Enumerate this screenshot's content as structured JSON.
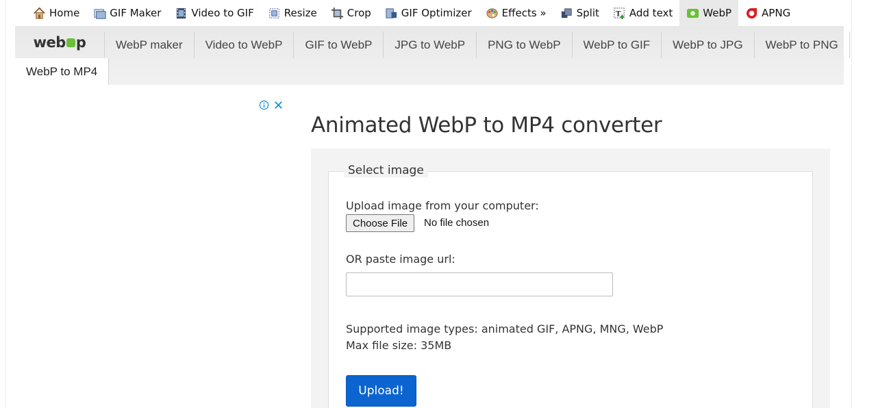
{
  "topnav": {
    "items": [
      {
        "label": "Home",
        "icon": "home-icon"
      },
      {
        "label": "GIF Maker",
        "icon": "gif-maker-icon"
      },
      {
        "label": "Video to GIF",
        "icon": "film-icon"
      },
      {
        "label": "Resize",
        "icon": "resize-icon"
      },
      {
        "label": "Crop",
        "icon": "crop-icon"
      },
      {
        "label": "GIF Optimizer",
        "icon": "optimizer-icon"
      },
      {
        "label": "Effects »",
        "icon": "palette-icon"
      },
      {
        "label": "Split",
        "icon": "split-icon"
      },
      {
        "label": "Add text",
        "icon": "add-text-icon"
      },
      {
        "label": "WebP",
        "icon": "webp-icon"
      },
      {
        "label": "APNG",
        "icon": "apng-icon"
      }
    ],
    "active": "WebP"
  },
  "subnav": {
    "logo_left": "web",
    "logo_right": "p",
    "links": [
      "WebP maker",
      "Video to WebP",
      "GIF to WebP",
      "JPG to WebP",
      "PNG to WebP",
      "WebP to GIF",
      "WebP to JPG",
      "WebP to PNG"
    ],
    "active_link": "WebP to MP4"
  },
  "main": {
    "title": "Animated WebP to MP4 converter",
    "legend": "Select image",
    "upload_label": "Upload image from your computer:",
    "file_button": "Choose File",
    "file_status": "No file chosen",
    "url_label": "OR paste image url:",
    "url_value": "",
    "supported_types": "Supported image types: animated GIF, APNG, MNG, WebP",
    "max_size": "Max file size: 35MB",
    "upload_button": "Upload!"
  },
  "colors": {
    "accent": "#0c64d0",
    "webp_green": "#6bbf3a",
    "apng_red": "#d4232a"
  }
}
